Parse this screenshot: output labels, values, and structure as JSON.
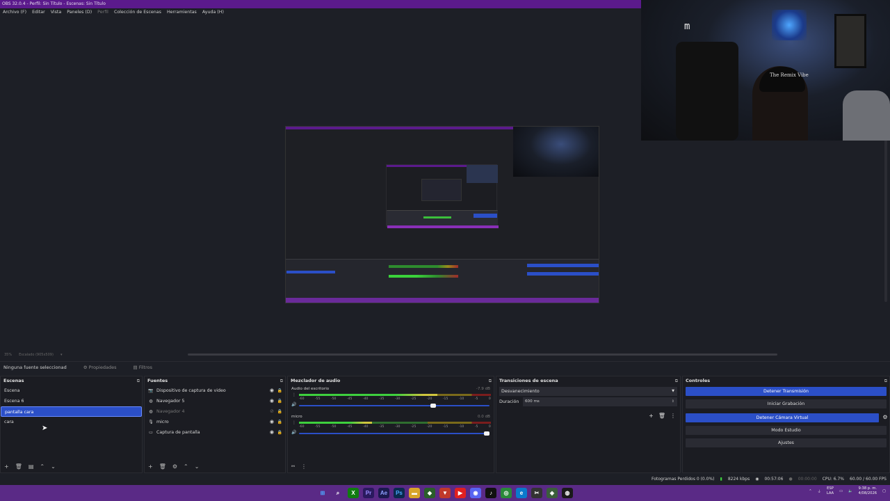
{
  "window": {
    "title": "OBS 32.0.4 - Perfil: Sin Título - Escenas: Sin Título"
  },
  "menu": [
    "Archivo (F)",
    "Editar",
    "Vista",
    "Paneles (D)",
    "Perfil",
    "Colección de Escenas",
    "Herramientas",
    "Ayuda (H)"
  ],
  "webcam": {
    "cap_text": "The Remix Vibe"
  },
  "preview": {
    "zoom": "35%",
    "scaling": "Escalado (905x509)"
  },
  "source_toolbar": {
    "no_source": "Ninguna fuente seleccionad",
    "properties": "Propiedades",
    "filters": "Filtros"
  },
  "scenes": {
    "title": "Escenas",
    "items": [
      {
        "label": "Escena",
        "selected": false
      },
      {
        "label": "Escena 6",
        "selected": false
      },
      {
        "label": "pantalla cara",
        "selected": true
      },
      {
        "label": "cara",
        "selected": false
      }
    ]
  },
  "sources": {
    "title": "Fuentes",
    "items": [
      {
        "label": "Dispositivo de captura de video",
        "icon": "camera-icon",
        "visible": true
      },
      {
        "label": "Navegador 5",
        "icon": "globe-icon",
        "visible": true
      },
      {
        "label": "Navegador 4",
        "icon": "globe-icon",
        "visible": false
      },
      {
        "label": "micro",
        "icon": "microphone-icon",
        "visible": true
      },
      {
        "label": "Captura de pantalla",
        "icon": "monitor-icon",
        "visible": true
      }
    ]
  },
  "mixer": {
    "title": "Mezclador de audio",
    "ticks": [
      "-60",
      "-55",
      "-50",
      "-45",
      "-40",
      "-35",
      "-30",
      "-25",
      "-20",
      "-15",
      "-10",
      "-5",
      "0"
    ],
    "tracks": [
      {
        "name": "Audio del escritorio",
        "db": "-7.9 dB",
        "level": 0.72,
        "volume": 0.71
      },
      {
        "name": "micro",
        "db": "0.0 dB",
        "level": 0.38,
        "volume": 1.0
      }
    ]
  },
  "transitions": {
    "title": "Transiciones de escena",
    "selected": "Desvanecimiento",
    "duration_label": "Duración",
    "duration_value": "600 ms"
  },
  "controls": {
    "title": "Controles",
    "stop_stream": "Detener Transmisión",
    "start_record": "Iniciar Grabación",
    "stop_virtualcam": "Detener Cámara Virtual",
    "studio_mode": "Modo Estudio",
    "settings": "Ajustes"
  },
  "status": {
    "dropped": "Fotogramas Perdidos 0 (0.0%)",
    "bitrate": "8224 kbps",
    "stream_time": "00:57:06",
    "rec_time": "00:00:00",
    "cpu": "CPU: 6.7%",
    "fps": "60.00 / 60.00 FPS"
  },
  "taskbar": {
    "lang_top": "ESP",
    "lang_bottom": "LAA",
    "time": "9:38 p. m.",
    "date": "4/08/2026"
  },
  "colors": {
    "accent": "#2b4fc7",
    "title_bar": "#5b1a8c",
    "taskbar": "#5a2a86"
  }
}
